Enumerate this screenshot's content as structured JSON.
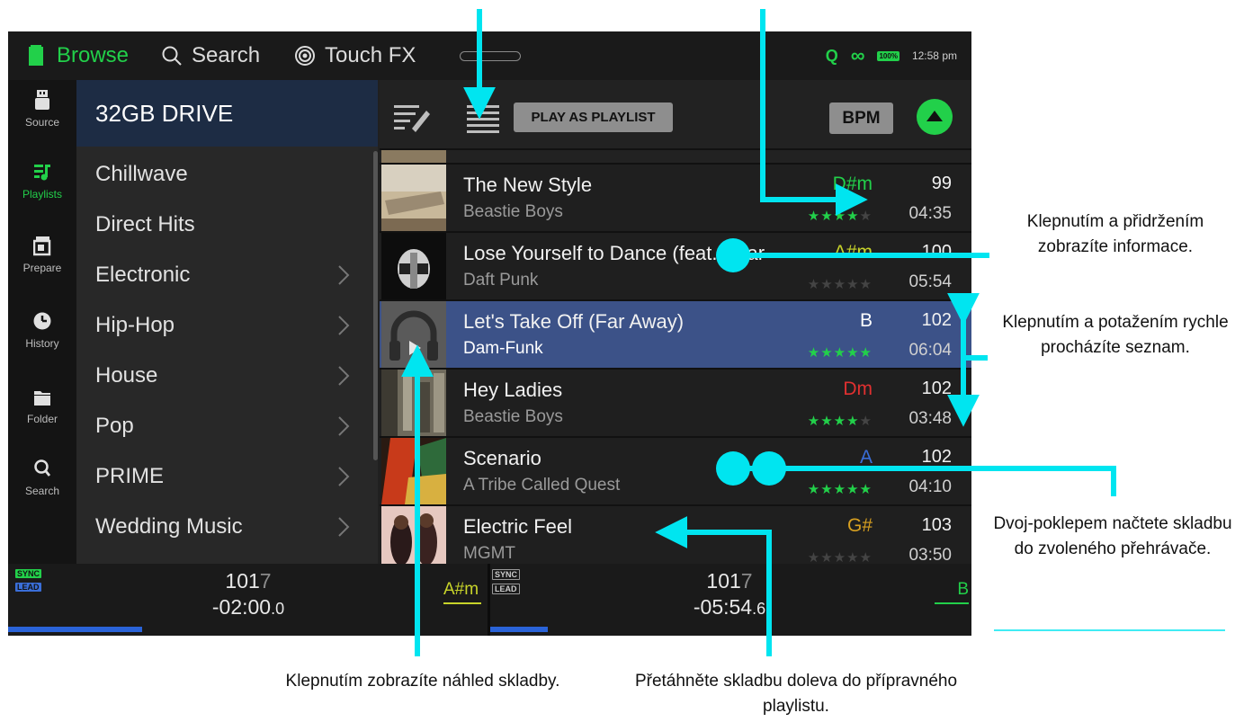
{
  "topbar": {
    "browse": "Browse",
    "search": "Search",
    "touchfx": "Touch FX",
    "q": "Q",
    "battery": "100%",
    "clock": "12:58 pm"
  },
  "sidebar": {
    "items": [
      {
        "label": "Source",
        "icon": "usb-drive-icon"
      },
      {
        "label": "Playlists",
        "icon": "playlist-icon"
      },
      {
        "label": "Prepare",
        "icon": "prepare-icon"
      },
      {
        "label": "History",
        "icon": "clock-icon"
      },
      {
        "label": "Folder",
        "icon": "folder-icon"
      },
      {
        "label": "Search",
        "icon": "search-icon"
      }
    ]
  },
  "crates": {
    "header": "32GB DRIVE",
    "items": [
      {
        "label": "Chillwave"
      },
      {
        "label": "Direct Hits"
      },
      {
        "label": "Electronic"
      },
      {
        "label": "Hip-Hop"
      },
      {
        "label": "House"
      },
      {
        "label": "Pop"
      },
      {
        "label": "PRIME"
      },
      {
        "label": "Wedding Music"
      }
    ]
  },
  "toolbar": {
    "play_as_playlist": "PLAY AS PLAYLIST",
    "bpm": "BPM"
  },
  "tracks": [
    {
      "title": "The New Style",
      "artist": "Beastie Boys",
      "key": "D#m",
      "key_color": "#22d04a",
      "bpm": "99",
      "duration": "04:35",
      "rating": 4
    },
    {
      "title": "Lose Yourself to Dance (feat. Phar",
      "artist": "Daft Punk",
      "key": "A#m",
      "key_color": "#c8d42a",
      "bpm": "100",
      "duration": "05:54",
      "rating": 0
    },
    {
      "title": "Let's Take Off (Far Away)",
      "artist": "Dam-Funk",
      "key": "B",
      "key_color": "#ffffff",
      "bpm": "102",
      "duration": "06:04",
      "rating": 5
    },
    {
      "title": "Hey Ladies",
      "artist": "Beastie Boys",
      "key": "Dm",
      "key_color": "#e03030",
      "bpm": "102",
      "duration": "03:48",
      "rating": 4
    },
    {
      "title": "Scenario",
      "artist": "A Tribe Called Quest",
      "key": "A",
      "key_color": "#3a6ed8",
      "bpm": "102",
      "duration": "04:10",
      "rating": 5
    },
    {
      "title": "Electric Feel",
      "artist": "MGMT",
      "key": "G#",
      "key_color": "#d8a020",
      "bpm": "103",
      "duration": "03:50",
      "rating": 0
    }
  ],
  "decks": {
    "left": {
      "sync": "SYNC",
      "lead": "LEAD",
      "bpm_main": "101",
      "bpm_dim": "7",
      "time_main": "-02:00",
      "time_dim": ".0",
      "key": "A#m",
      "key_color": "#c8d42a",
      "progress": 0.28
    },
    "right": {
      "sync": "SYNC",
      "lead": "LEAD",
      "bpm_main": "101",
      "bpm_dim": "7",
      "time_main": "-05:54",
      "time_dim": ".6",
      "key": "B",
      "key_color": "#22d04a",
      "progress": 0.12
    }
  },
  "annotations": {
    "hold_info": "Klepnutím a přidržením zobrazíte informace.",
    "drag_scroll": "Klepnutím a potažením rychle procházíte seznam.",
    "double_tap": "Dvoj-poklepem načtete skladbu do zvoleného přehrávače.",
    "preview": "Klepnutím zobrazíte náhled skladby.",
    "drag_prepare": "Přetáhněte skladbu doleva do přípravného playlistu."
  },
  "colors": {
    "accent_green": "#22d04a",
    "highlight_blue": "#3c5288",
    "callout_cyan": "#00e5f0"
  }
}
